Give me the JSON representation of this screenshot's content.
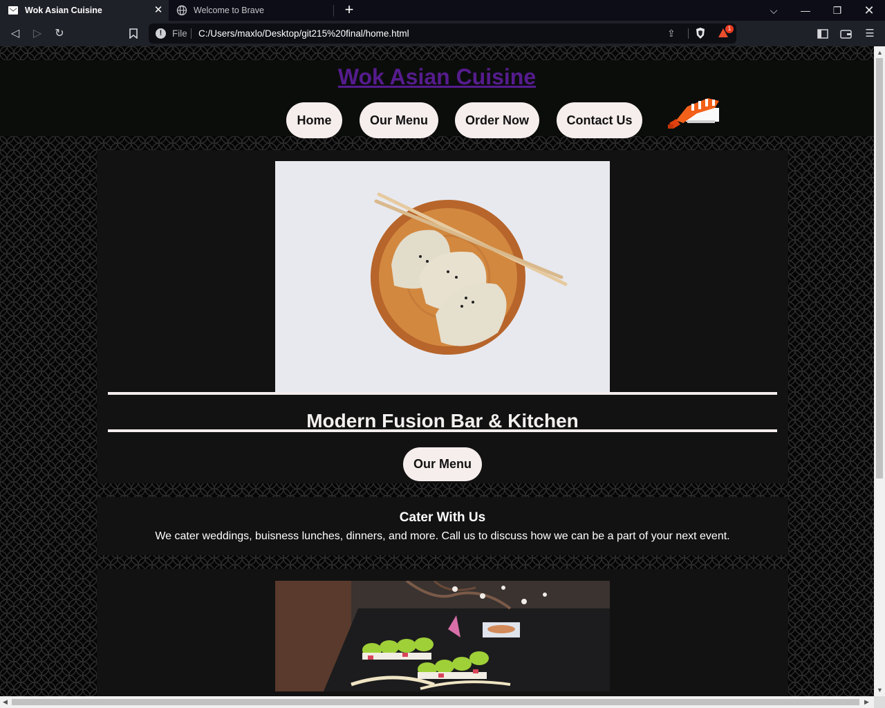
{
  "browser": {
    "tabs": [
      {
        "title": "Wok Asian Cuisine",
        "active": true
      },
      {
        "title": "Welcome to Brave",
        "active": false
      }
    ],
    "url_scheme": "File",
    "url": "C:/Users/maxlo/Desktop/git215%20final/home.html",
    "rewards_badge": "1"
  },
  "site": {
    "title": "Wok Asian Cuisine",
    "nav": [
      "Home",
      "Our Menu",
      "Order Now",
      "Contact Us"
    ],
    "hero_heading": "Modern Fusion Bar & Kitchen",
    "hero_button": "Our Menu",
    "cater_title": "Cater With Us",
    "cater_text": "We cater weddings, buisness lunches, dinners, and more. Call us to discuss how we can be a part of your next event.",
    "hero_image_icon": "dumplings-photo",
    "second_image_icon": "sushi-photo",
    "mascot_icon": "shrimp-nigiri-icon"
  },
  "colors": {
    "title": "#561c8e",
    "button_bg": "#f6eeec",
    "card_bg": "#121212",
    "header_bg": "#0b0d0b"
  }
}
